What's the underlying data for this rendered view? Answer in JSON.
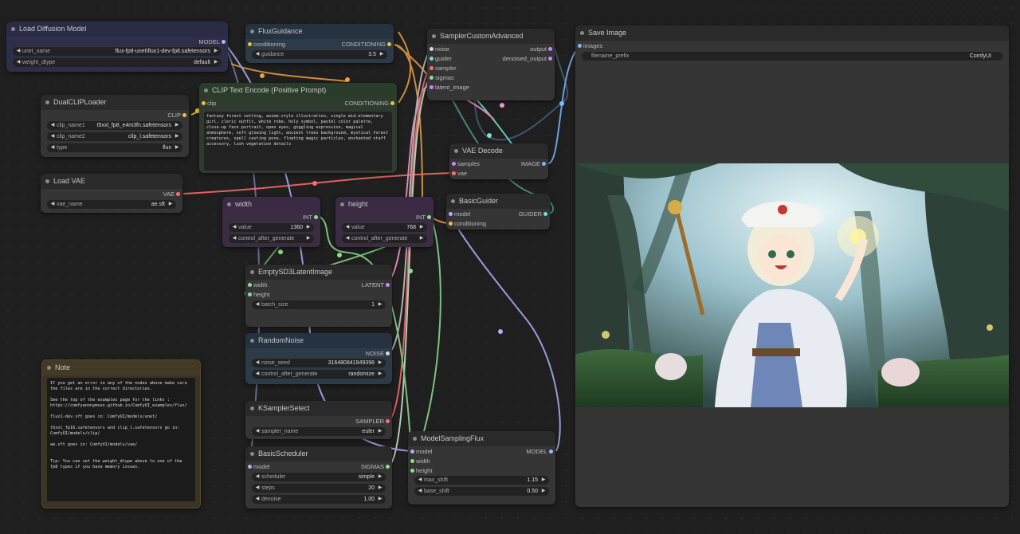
{
  "nodes": {
    "load_diffusion": {
      "title": "Load Diffusion Model",
      "out_model": "MODEL",
      "unet_name_label": "unet_name",
      "unet_name_value": "flux-fp8-unet\\flux1-dev-fp8.safetensors",
      "weight_dtype_label": "weight_dtype",
      "weight_dtype_value": "default"
    },
    "flux_guidance": {
      "title": "FluxGuidance",
      "in_conditioning": "conditioning",
      "out_conditioning": "CONDITIONING",
      "guidance_label": "guidance",
      "guidance_value": "3.5"
    },
    "sampler_custom_adv": {
      "title": "SamplerCustomAdvanced",
      "inputs": [
        "noise",
        "guider",
        "sampler",
        "sigmas",
        "latent_image"
      ],
      "out_output": "output",
      "out_denoised": "denoised_output"
    },
    "save_image": {
      "title": "Save Image",
      "in_images": "images",
      "filename_prefix_label": "filename_prefix",
      "filename_prefix_value": "ComfyUI"
    },
    "dual_clip": {
      "title": "DualCLIPLoader",
      "out_clip": "CLIP",
      "clip_name1_label": "clip_name1",
      "clip_name1_value": "t5xxl_fp8_e4m3fn.safetensors",
      "clip_name2_label": "clip_name2",
      "clip_name2_value": "clip_l.safetensors",
      "type_label": "type",
      "type_value": "flux"
    },
    "clip_text_encode": {
      "title": "CLIP Text Encode (Positive Prompt)",
      "in_clip": "clip",
      "out_conditioning": "CONDITIONING",
      "text": "fantasy forest setting, anime-style illustration, single mid-elementary girl, cleric outfit, white robe, holy symbol, pastel color palette, close-up face portrait, open eyes, giggling expression, magical atmosphere, soft glowing light, ancient trees background, mystical forest creatures, spell casting pose, floating magic particles, enchanted staff accessory, lush vegetation details"
    },
    "vae_decode": {
      "title": "VAE Decode",
      "in_samples": "samples",
      "in_vae": "vae",
      "out_image": "IMAGE"
    },
    "load_vae": {
      "title": "Load VAE",
      "out_vae": "VAE",
      "vae_name_label": "vae_name",
      "vae_name_value": "ae.sft"
    },
    "width": {
      "title": "width",
      "out_int": "INT",
      "value_label": "value",
      "value_value": "1360",
      "control_label": "control_after_generate",
      "control_value": ""
    },
    "height": {
      "title": "height",
      "out_int": "INT",
      "value_label": "value",
      "value_value": "768",
      "control_label": "control_after_generate",
      "control_value": ""
    },
    "basic_guider": {
      "title": "BasicGuider",
      "in_model": "model",
      "in_conditioning": "conditioning",
      "out_guider": "GUIDER"
    },
    "empty_latent": {
      "title": "EmptySD3LatentImage",
      "in_width": "width",
      "in_height": "height",
      "out_latent": "LATENT",
      "batch_label": "batch_size",
      "batch_value": "1"
    },
    "random_noise": {
      "title": "RandomNoise",
      "out_noise": "NOISE",
      "seed_label": "noise_seed",
      "seed_value": "316480841949398",
      "control_label": "control_after_generate",
      "control_value": "randomize"
    },
    "note": {
      "title": "Note",
      "text": "If you get an error in any of the nodes above make sure the files are in the correct directories.\n\nSee the top of the examples page for the links :\nhttps://comfyanonymous.github.io/ComfyUI_examples/flux/\n\nflux1-dev.sft goes in: ComfyUI/models/unet/\n\nt5xxl_fp16.safetensors and clip_l.safetensors go in:\nComfyUI/models/clip/\n\nae.sft goes in: ComfyUI/models/vae/\n\n\nTip: You can set the weight_dtype above to one of the fp8 types if you have memory issues."
    },
    "ksampler_select": {
      "title": "KSamplerSelect",
      "out_sampler": "SAMPLER",
      "sampler_label": "sampler_name",
      "sampler_value": "euler"
    },
    "basic_scheduler": {
      "title": "BasicScheduler",
      "in_model": "model",
      "out_sigmas": "SIGMAS",
      "scheduler_label": "scheduler",
      "scheduler_value": "simple",
      "steps_label": "steps",
      "steps_value": "20",
      "denoise_label": "denoise",
      "denoise_value": "1.00"
    },
    "model_sampling_flux": {
      "title": "ModelSamplingFlux",
      "in_model": "model",
      "in_width": "width",
      "in_height": "height",
      "out_model": "MODEL",
      "max_shift_label": "max_shift",
      "max_shift_value": "1.15",
      "base_shift_label": "base_shift",
      "base_shift_value": "0.50"
    }
  },
  "arrows": {
    "left": "◀",
    "right": "▶"
  },
  "colors": {
    "clip": "#f0c040",
    "conditioning": "#f0a040",
    "model": "#b0b0ff",
    "vae": "#ff6e6e",
    "int": "#8ddf8d",
    "latent": "#ff9ccf",
    "image": "#7ab8ff",
    "noise": "#c8c8c8",
    "sampler": "#ff6e6e",
    "sigmas": "#cfeacf",
    "guider": "#6ee6d6"
  }
}
